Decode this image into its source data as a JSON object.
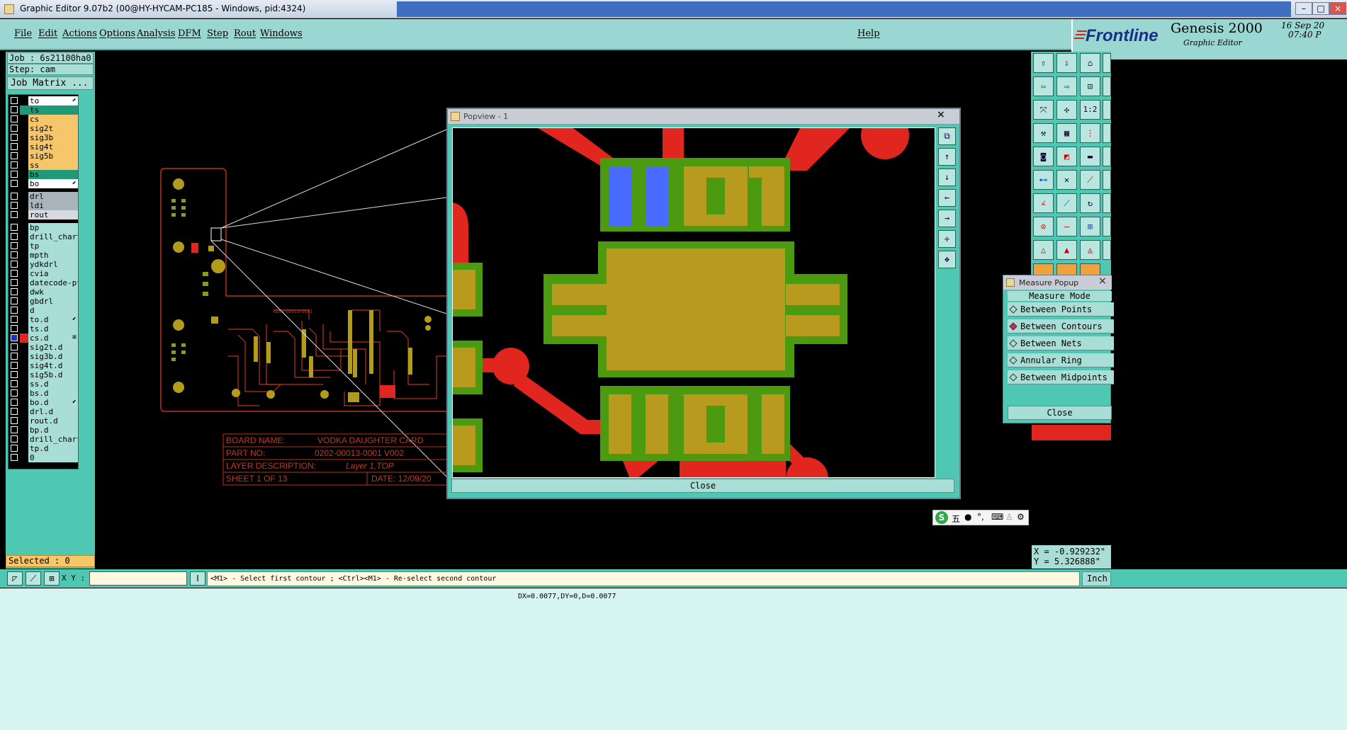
{
  "window": {
    "title": "Graphic Editor 9.07b2 (00@HY-HYCAM-PC185 - Windows, pid:4324)",
    "minimize_icon": "minimize-icon",
    "maximize_icon": "maximize-icon",
    "close_icon": "close-icon"
  },
  "menu": [
    "File",
    "Edit",
    "Actions",
    "Options",
    "Analysis",
    "DFM",
    "Step",
    "Rout",
    "Windows"
  ],
  "help_label": "Help",
  "brand": {
    "logo": "Frontline",
    "product": "Genesis 2000",
    "subtitle": "Graphic Editor",
    "date": "16 Sep 20",
    "time": "07:40 P"
  },
  "job": {
    "job_line": "Job : 6s21100ha0",
    "step_line": "Step: cam",
    "matrix_button": "Job Matrix ..."
  },
  "layers": [
    {
      "name": "to",
      "color": "#ffffff",
      "swatch": "#000000",
      "mark": "⬋"
    },
    {
      "name": "ts",
      "color": "#1f9a78",
      "swatch": "#1f9a78",
      "mark": ""
    },
    {
      "name": "cs",
      "color": "#f5c66a",
      "swatch": "#000000",
      "mark": ""
    },
    {
      "name": "sig2t",
      "color": "#f5c66a",
      "swatch": "#000000",
      "mark": ""
    },
    {
      "name": "sig3b",
      "color": "#f5c66a",
      "swatch": "#000000",
      "mark": ""
    },
    {
      "name": "sig4t",
      "color": "#f5c66a",
      "swatch": "#000000",
      "mark": ""
    },
    {
      "name": "sig5b",
      "color": "#f5c66a",
      "swatch": "#000000",
      "mark": ""
    },
    {
      "name": "ss",
      "color": "#f5c66a",
      "swatch": "#000000",
      "mark": ""
    },
    {
      "name": "bs",
      "color": "#1f9a78",
      "swatch": "#000000",
      "mark": ""
    },
    {
      "name": "bo",
      "color": "#ffffff",
      "swatch": "#000000",
      "mark": "⬋"
    },
    {
      "name": "drl",
      "color": "#a9b4bd",
      "swatch": "#000000",
      "mark": ""
    },
    {
      "name": "ldi",
      "color": "#a9b4bd",
      "swatch": "#000000",
      "mark": ""
    },
    {
      "name": "rout",
      "color": "#d7dbe0",
      "swatch": "#000000",
      "mark": ""
    },
    {
      "name": "bp",
      "color": "#a9ded6",
      "swatch": "#000000",
      "mark": ""
    },
    {
      "name": "drill_chart",
      "color": "#a9ded6",
      "swatch": "#000000",
      "mark": ""
    },
    {
      "name": "tp",
      "color": "#a9ded6",
      "swatch": "#000000",
      "mark": ""
    },
    {
      "name": "mpth",
      "color": "#a9ded6",
      "swatch": "#000000",
      "mark": ""
    },
    {
      "name": "ydkdrl",
      "color": "#a9ded6",
      "swatch": "#000000",
      "mark": ""
    },
    {
      "name": "cvia",
      "color": "#a9ded6",
      "swatch": "#000000",
      "mark": ""
    },
    {
      "name": "datecode-pt",
      "color": "#a9ded6",
      "swatch": "#000000",
      "mark": ""
    },
    {
      "name": "dwk",
      "color": "#a9ded6",
      "swatch": "#000000",
      "mark": ""
    },
    {
      "name": "gbdrl",
      "color": "#a9ded6",
      "swatch": "#000000",
      "mark": ""
    },
    {
      "name": "d",
      "color": "#a9ded6",
      "swatch": "#000000",
      "mark": ""
    },
    {
      "name": "to.d",
      "color": "#a9ded6",
      "swatch": "#000000",
      "mark": "⬋"
    },
    {
      "name": "ts.d",
      "color": "#a9ded6",
      "swatch": "#000000",
      "mark": ""
    },
    {
      "name": "cs.d",
      "color": "#a9ded6",
      "swatch": "#e0261f",
      "mark": "≡",
      "checked": true
    },
    {
      "name": "sig2t.d",
      "color": "#a9ded6",
      "swatch": "#000000",
      "mark": ""
    },
    {
      "name": "sig3b.d",
      "color": "#a9ded6",
      "swatch": "#000000",
      "mark": ""
    },
    {
      "name": "sig4t.d",
      "color": "#a9ded6",
      "swatch": "#000000",
      "mark": ""
    },
    {
      "name": "sig5b.d",
      "color": "#a9ded6",
      "swatch": "#000000",
      "mark": ""
    },
    {
      "name": "ss.d",
      "color": "#a9ded6",
      "swatch": "#000000",
      "mark": ""
    },
    {
      "name": "bs.d",
      "color": "#a9ded6",
      "swatch": "#000000",
      "mark": ""
    },
    {
      "name": "bo.d",
      "color": "#a9ded6",
      "swatch": "#000000",
      "mark": "⬋"
    },
    {
      "name": "drl.d",
      "color": "#a9ded6",
      "swatch": "#000000",
      "mark": ""
    },
    {
      "name": "rout.d",
      "color": "#a9ded6",
      "swatch": "#000000",
      "mark": ""
    },
    {
      "name": "bp.d",
      "color": "#a9ded6",
      "swatch": "#000000",
      "mark": ""
    },
    {
      "name": "drill_chart",
      "color": "#a9ded6",
      "swatch": "#000000",
      "mark": ""
    },
    {
      "name": "tp.d",
      "color": "#a9ded6",
      "swatch": "#000000",
      "mark": ""
    },
    {
      "name": "0",
      "color": "#a9ded6",
      "swatch": "#000000",
      "mark": ""
    }
  ],
  "selected": "Selected : 0",
  "board_title": {
    "board_name_label": "BOARD NAME:",
    "board_name": "VODKA DAUGHTER CARD",
    "part_no_label": "PART NO:",
    "part_no": "0202-00013-0001 V002",
    "layer_desc_label": "LAYER DESCRIPTION:",
    "layer_desc": "Layer 1,TOP",
    "sheet": "SHEET  1  OF 13",
    "date": "DATE: 12/09/20",
    "silk_label": "0202-00013-0001"
  },
  "popview": {
    "title": "Popview - 1",
    "close_label": "Close"
  },
  "measure": {
    "title": "Measure Popup",
    "header": "Measure Mode",
    "options": [
      "Between Points",
      "Between Contours",
      "Between Nets",
      "Annular Ring",
      "Between Midpoints"
    ],
    "selected_index": 1,
    "close_label": "Close"
  },
  "coords": {
    "x": "X = -0.929232\"",
    "y": "Y = 5.326888\""
  },
  "bottom": {
    "xy_label": "X Y :",
    "xy_value": "",
    "prompt": "<M1> - Select first contour ; <Ctrl><M1> - Re-select second contour",
    "units": "Inch",
    "status": "DX=0.0077,DY=0,D=0.0077"
  },
  "ime": {
    "logo": "S",
    "mode": "五"
  }
}
